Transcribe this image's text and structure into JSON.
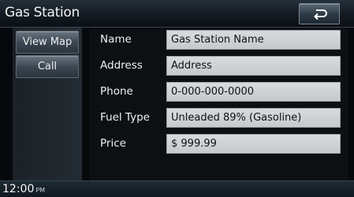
{
  "window": {
    "title": "Gas Station"
  },
  "sidebar": {
    "view_map": "View Map",
    "call": "Call"
  },
  "details": {
    "name": {
      "label": "Name",
      "value": "Gas Station Name"
    },
    "address": {
      "label": "Address",
      "value": "Address"
    },
    "phone": {
      "label": "Phone",
      "value": "0-000-000-0000"
    },
    "fuel_type": {
      "label": "Fuel Type",
      "value": "Unleaded 89% (Gasoline)"
    },
    "price": {
      "label": "Price",
      "value": "$ 999.99"
    }
  },
  "status": {
    "time": "12:00",
    "ampm": "PM"
  },
  "icons": {
    "back": "back-arrow-icon"
  }
}
